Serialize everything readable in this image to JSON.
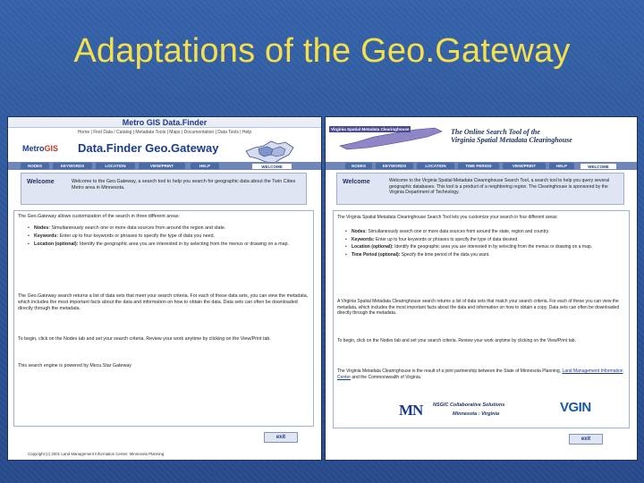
{
  "slide": {
    "title": "Adaptations of the Geo.Gateway",
    "background": "#2f5596",
    "title_color": "#f4e04d"
  },
  "left": {
    "banner_title": "Metro GIS Data.Finder",
    "topnav": "Home  |  Find Data / Catalog  |  Metadata Tools  |  Maps  |  Documentation  |  Data Tools  |  Help",
    "logo_text": "Metro",
    "logo_gis": "GIS",
    "app_title": "Data.Finder Geo.Gateway",
    "tabs": [
      "NODES",
      "KEYWORDS",
      "LOCATION",
      "VIEW/PRINT",
      "HELP",
      "WELCOME"
    ],
    "welcome_label": "Welcome",
    "welcome_text": "Welcome to the Geo.Gateway, a search tool to help you search for geographic data about the Twin Cities Metro area in Minnesota.",
    "intro": "The Geo.Gateway allows customization of the search in three different areas:",
    "bullets": [
      {
        "label": "Nodes:",
        "text": "Simultaneously search one or more data sources from around the region and state."
      },
      {
        "label": "Keywords:",
        "text": "Enter up to four keywords or phrases to specify the type of data you need."
      },
      {
        "label": "Location (optional):",
        "text": "Identify the geographic area you are interested in by selecting from the menus or drawing on a map."
      }
    ],
    "para2": "The Geo.Gateway search returns a list of data sets that meet your search criteria. For each of these data sets, you can view the metadata, which includes the most important facts about the data and information on how to obtain the data. Data sets can often be downloaded directly through the metadata.",
    "para3": "To begin, click on the Nodes tab and set your search criteria. Review your work anytime by clicking on the View/Print tab.",
    "para4": "This search engine is powered by Mecu.Star Gateway",
    "exit_label": "exit",
    "footer": "Copyright (c) 2001 Land Management Information Center, Minnesota Planning"
  },
  "right": {
    "logo_text": "Virginia Spatial Metadata Clearinghouse",
    "title_line1": "The Online Search Tool of the",
    "title_line2": "Virginia Spatial Metadata Clearinghouse",
    "tabs": [
      "NODES",
      "KEYWORDS",
      "LOCATION",
      "TIME PERIOD",
      "VIEW/PRINT",
      "HELP",
      "WELCOME"
    ],
    "welcome_label": "Welcome",
    "welcome_text": "Welcome to the Virginia Spatial Metadata Clearinghouse Search Tool, a search tool to help you query several geographic databases. This tool is a product of a neighboring region. The Clearinghouse is sponsored by the Virginia Department of Technology.",
    "intro": "The Virginia Spatial Metadata Clearinghouse Search Tool lets you customize your search in four different areas:",
    "bullets": [
      {
        "label": "Nodes:",
        "text": "Simultaneously search one or more data sources from around the state, region and country."
      },
      {
        "label": "Keywords:",
        "text": "Enter up to four keywords or phrases to specify the type of data desired."
      },
      {
        "label": "Location (optional):",
        "text": "Identify the geographic area you are interested in by selecting from the menus or drawing on a map."
      },
      {
        "label": "Time Period (optional):",
        "text": "Specify the time period of the data you want."
      }
    ],
    "para2": "A Virginia Spatial Metadata Clearinghouse search returns a list of data sets that match your search criteria. For each of these you can view the metadata, which includes the most important facts about the data and information on how to obtain a copy. Data sets can often be downloaded directly through the metadata.",
    "para3": "To begin, click on the Nodes tab and set your search criteria. Review your work anytime by clicking on the View/Print tab.",
    "para4_pre": "The Virginia Metadata Clearinghouse is the result of a joint partnership between the State of Minnesota Planning,",
    "para4_link": "Land Management Information Center",
    "para4_post": "and the Commonwealth of Virginia.",
    "partner_line1": "NSGIC Collaborative Solutions",
    "partner_line2": "Minnesota : Virginia",
    "mn_logo": "MN",
    "vgin_logo": "VGIN",
    "exit_label": "exit"
  }
}
